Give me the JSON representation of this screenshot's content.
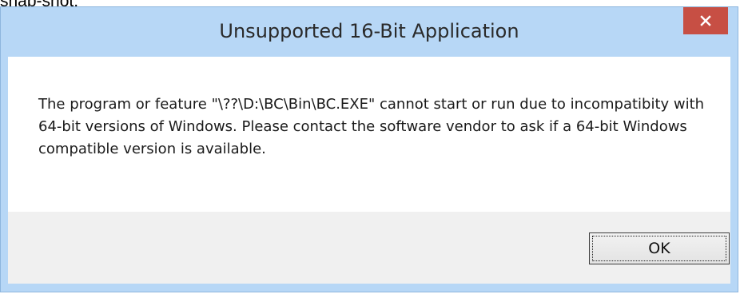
{
  "page": {
    "snippet_text": "snap-shot:"
  },
  "dialog": {
    "title": "Unsupported 16-Bit Application",
    "message": "The program or feature \"\\??\\D:\\BC\\Bin\\BC.EXE\" cannot start or run due to incompatibity with 64-bit versions of Windows. Please contact the software vendor to ask if a 64-bit Windows compatible version is available.",
    "ok_label": "OK",
    "close_icon": "close-icon"
  },
  "colors": {
    "frame": "#b7d7f6",
    "close_button": "#c74f44",
    "content_bg": "#ffffff",
    "button_area_bg": "#f0f0f0"
  }
}
